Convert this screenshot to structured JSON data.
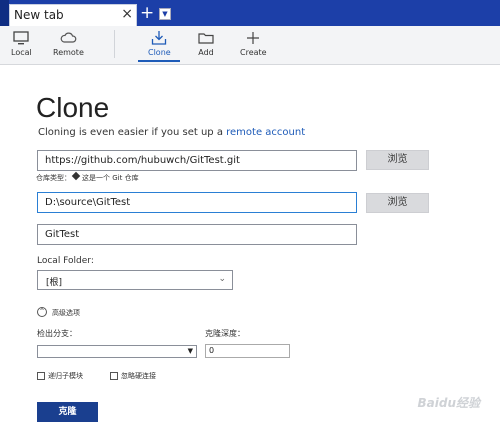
{
  "tabs": {
    "active_title": "New tab",
    "close_glyph": "×",
    "new_tab_glyph": "+",
    "dropdown_glyph": "▼"
  },
  "toolbar": {
    "items": [
      {
        "label": "Local",
        "icon": "monitor-icon"
      },
      {
        "label": "Remote",
        "icon": "cloud-icon"
      },
      {
        "label": "Clone",
        "icon": "download-icon",
        "active": true
      },
      {
        "label": "Add",
        "icon": "folder-icon"
      },
      {
        "label": "Create",
        "icon": "plus-icon"
      }
    ],
    "accent": "#1e5bb8"
  },
  "page": {
    "title": "Clone",
    "subtitle_prefix": "Cloning is even easier if you set up a ",
    "subtitle_link": "remote account"
  },
  "form": {
    "source_url": "https://github.com/hubuwch/GitTest.git",
    "browse_label_1": "浏览",
    "repo_type_prefix": "仓库类型：",
    "repo_type_value": "这是一个 Git 仓库",
    "destination_path": "D:\\source\\GitTest",
    "browse_label_2": "浏览",
    "name": "GitTest",
    "local_folder_label": "Local Folder:",
    "local_folder_value": "[根]",
    "advanced_label": "高级选项",
    "branch_label": "检出分支：",
    "branch_value": "",
    "depth_label": "克隆深度：",
    "depth_value": "0",
    "recurse_label": "递归子模块",
    "ignore_hardlinks_label": "忽略硬连接",
    "clone_button": "克隆"
  },
  "watermark": "Baidu经验"
}
